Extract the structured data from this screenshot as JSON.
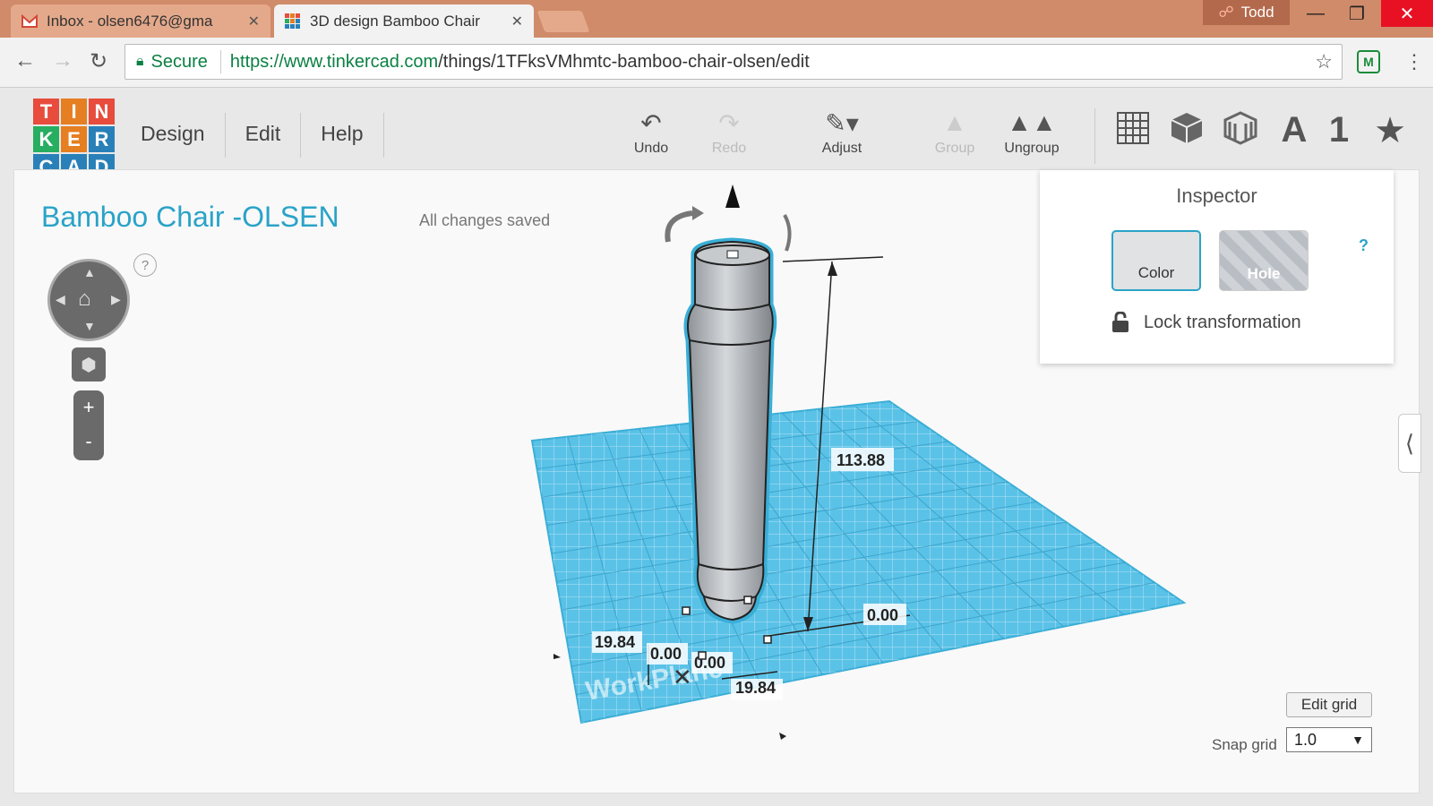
{
  "browser": {
    "tabs": [
      {
        "title": "Inbox - olsen6476@gma",
        "icon": "gmail-icon",
        "active": false
      },
      {
        "title": "3D design Bamboo Chair",
        "icon": "tinkercad-icon",
        "active": true
      }
    ],
    "user": "Todd",
    "secure_label": "Secure",
    "url_host": "https://www.tinkercad.com",
    "url_path": "/things/1TFksVMhmtc-bamboo-chair-olsen/edit",
    "extension_label": "M"
  },
  "app": {
    "logo_letters": [
      "T",
      "I",
      "N",
      "K",
      "E",
      "R",
      "C",
      "A",
      "D"
    ],
    "logo_colors": [
      "#e74c3c",
      "#e67e22",
      "#e74c3c",
      "#27ae60",
      "#e67e22",
      "#2980b9",
      "#2980b9",
      "#2980b9",
      "#2980b9"
    ],
    "menu": [
      "Design",
      "Edit",
      "Help"
    ],
    "toolbar": {
      "undo": "Undo",
      "redo": "Redo",
      "adjust": "Adjust",
      "group": "Group",
      "ungroup": "Ungroup"
    },
    "right_tools": [
      "grid-icon",
      "cube-icon",
      "striped-cube-icon",
      "A",
      "1",
      "star-icon"
    ]
  },
  "workspace": {
    "title": "Bamboo Chair -OLSEN",
    "status": "All changes saved",
    "help": "?",
    "zoom_in": "+",
    "zoom_out": "-",
    "workplane_label": "WorkPlane"
  },
  "dimensions": {
    "height": "113.88",
    "width": "19.84",
    "depth": "19.84",
    "x_offset": "0.00",
    "y_offset": "0.00",
    "z_offset": "0.00"
  },
  "inspector": {
    "title": "Inspector",
    "color_label": "Color",
    "hole_label": "Hole",
    "help": "?",
    "lock_label": "Lock transformation"
  },
  "grid": {
    "edit_label": "Edit grid",
    "snap_label": "Snap grid",
    "snap_value": "1.0"
  }
}
